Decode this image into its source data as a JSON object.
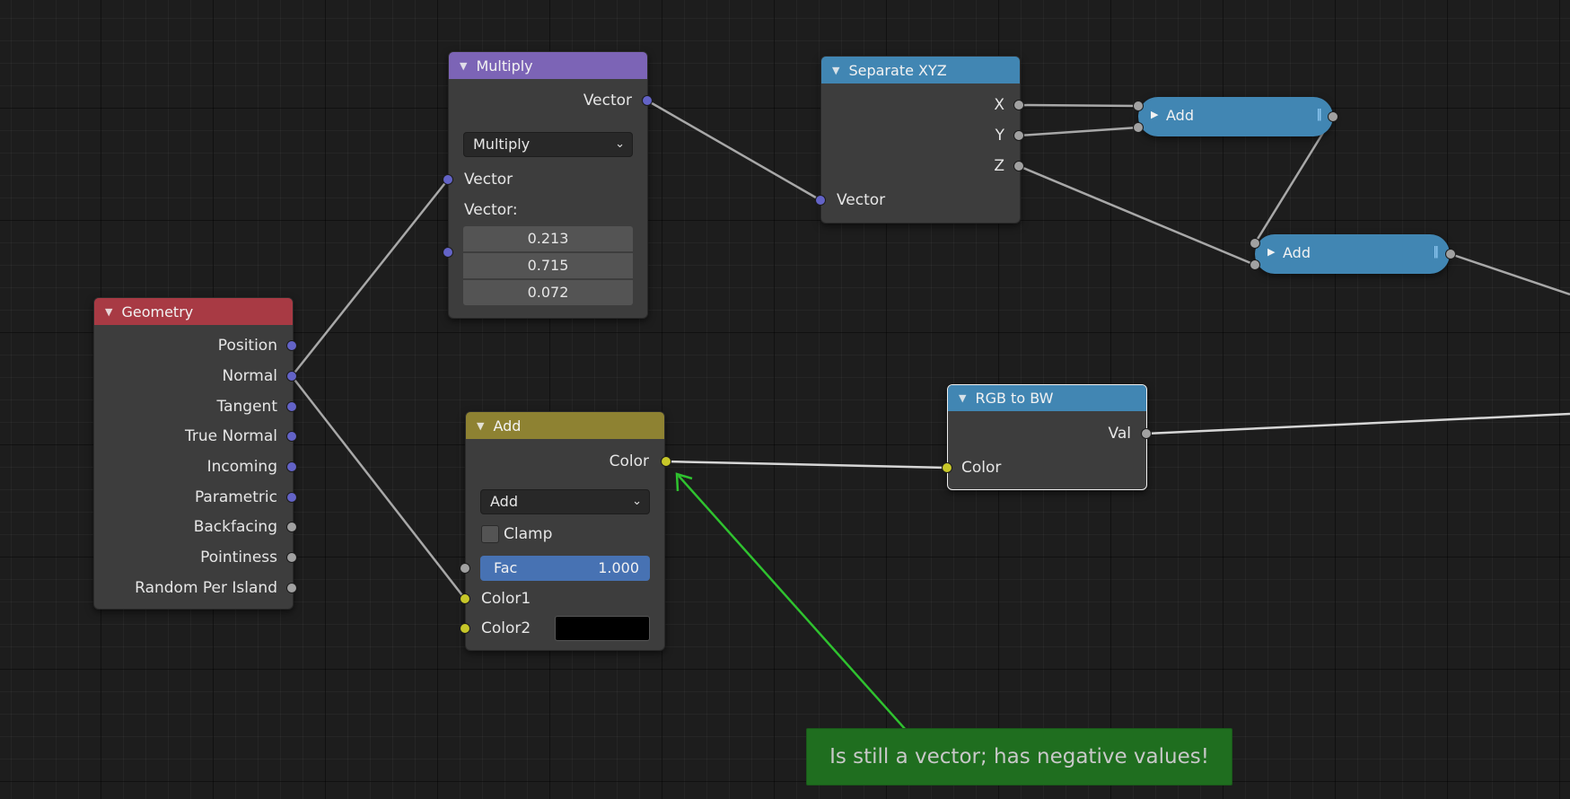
{
  "colors": {
    "geometry_header": "#a83a44",
    "multiply_header": "#7c64b6",
    "add_color_header": "#8e8232",
    "separate_header": "#4186b3",
    "rgb_header": "#4186b3",
    "vector_socket": "#6363c7",
    "float_socket": "#a1a1a1",
    "color_socket": "#c7c729",
    "note_arrow": "#2fc22f"
  },
  "geometry": {
    "title": "Geometry",
    "outputs": [
      "Position",
      "Normal",
      "Tangent",
      "True Normal",
      "Incoming",
      "Parametric",
      "Backfacing",
      "Pointiness",
      "Random Per Island"
    ]
  },
  "multiply": {
    "title": "Multiply",
    "output": "Vector",
    "operation": "Multiply",
    "input": "Vector",
    "vector_label": "Vector:",
    "values": [
      "0.213",
      "0.715",
      "0.072"
    ]
  },
  "add_color": {
    "title": "Add",
    "output": "Color",
    "blend_mode": "Add",
    "clamp_label": "Clamp",
    "fac_label": "Fac",
    "fac_value": "1.000",
    "color1": "Color1",
    "color2": "Color2"
  },
  "separate_xyz": {
    "title": "Separate XYZ",
    "outputs": [
      "X",
      "Y",
      "Z"
    ],
    "input": "Vector"
  },
  "math_add_1": {
    "title": "Add"
  },
  "math_add_2": {
    "title": "Add"
  },
  "rgb_to_bw": {
    "title": "RGB to BW",
    "output": "Val",
    "input": "Color"
  },
  "note": {
    "text": "Is still a vector; has negative values!"
  },
  "icons": {
    "collapse": "collapse-triangle-icon",
    "expand": "expand-triangle-icon",
    "chevron": "chevron-down-icon"
  }
}
